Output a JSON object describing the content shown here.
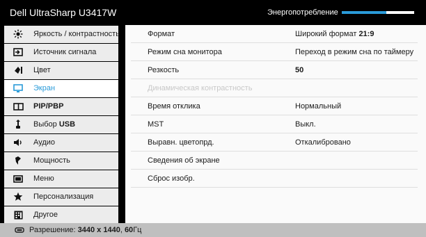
{
  "header": {
    "title": "Dell UltraSharp U3417W",
    "energy_label": "Энергопотребление",
    "energy_level": 0.62
  },
  "sidebar": {
    "items": [
      {
        "label": "Яркость / контрастность",
        "icon": "brightness-icon"
      },
      {
        "label": "Источник сигнала",
        "icon": "input-source-icon"
      },
      {
        "label": "Цвет",
        "icon": "color-icon"
      },
      {
        "label": "Экран",
        "icon": "display-icon",
        "active": true
      },
      {
        "label_prefix": "",
        "label_bold": "PIP/PBP",
        "icon": "pip-pbp-icon"
      },
      {
        "label_prefix": "Выбор ",
        "label_bold": "USB",
        "icon": "usb-icon"
      },
      {
        "label": "Аудио",
        "icon": "audio-icon"
      },
      {
        "label": "Мощность",
        "icon": "power-icon"
      },
      {
        "label": "Меню",
        "icon": "menu-icon"
      },
      {
        "label": "Персонализация",
        "icon": "star-icon"
      },
      {
        "label": "Другое",
        "icon": "other-icon"
      }
    ]
  },
  "panel": {
    "rows": [
      {
        "key": "Формат",
        "value_prefix": "Широкий формат ",
        "value_bold": "21:9"
      },
      {
        "key": "Режим сна монитора",
        "value": "Переход в режим сна по таймеру"
      },
      {
        "key": "Резкость",
        "value_bold": "50"
      },
      {
        "key": "Динамическая контрастность",
        "disabled": true
      },
      {
        "key": "Время отклика",
        "value": "Нормальный"
      },
      {
        "key": "MST",
        "value": "Выкл."
      },
      {
        "key": "Выравн. цветопрд.",
        "value": "Откалибровано"
      },
      {
        "key": "Сведения об экране"
      },
      {
        "key": "Сброс изобр."
      }
    ]
  },
  "footer": {
    "prefix": "Разрешение: ",
    "resolution": "3440 x 1440",
    "separator": ", ",
    "refresh": "60",
    "unit": "Гц"
  },
  "colors": {
    "accent": "#2a9bd9",
    "background": "#000000",
    "menu_bg": "#ececec",
    "panel_bg": "#fafafa",
    "footer_bg": "#bfbfbf"
  }
}
